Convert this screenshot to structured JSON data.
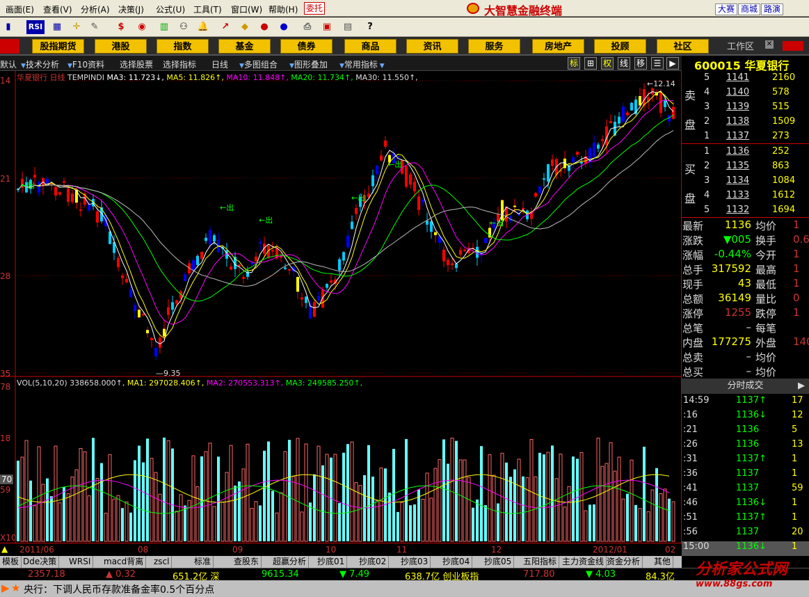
{
  "menu": {
    "items": [
      "画面(E)",
      "查看(V)",
      "分析(A)",
      "决策(J)",
      "公式(U)",
      "工具(T)",
      "窗口(W)",
      "帮助(H)"
    ],
    "entrust": "委托",
    "brand": "大智慧金融终端",
    "right_buttons": [
      "大赛",
      "商城",
      "路演"
    ]
  },
  "toolbar": {
    "rsi": "RSI",
    "dollar": "$"
  },
  "categories": [
    "股指期货",
    "港股",
    "指数",
    "基金",
    "债券",
    "商品",
    "资讯",
    "服务",
    "房地产",
    "投顾",
    "社区"
  ],
  "workarea": "工作区",
  "funcbar": {
    "items": [
      "默认",
      "技术分析",
      "F10资料",
      "选择股票",
      "选择指标",
      "日线",
      "多图组合",
      "图形叠加",
      "常用指标"
    ],
    "squares": [
      "标",
      "⊞",
      "权",
      "线",
      "移",
      "☰",
      "▶"
    ]
  },
  "stock": {
    "code_name": "600015 华夏银行"
  },
  "main_legend": {
    "name": "华夏银行",
    "period": "日线",
    "ind": "TEMPINDI",
    "ma3": "MA3: 11.723",
    "ma5": "MA5: 11.826",
    "ma10": "MA10: 11.848",
    "ma20": "MA20: 11.734",
    "ma30": "MA30: 11.550"
  },
  "vol_legend": {
    "vol": "VOL(5,10,20) 338658.000",
    "ma1": "MA1: 297028.406",
    "ma2": "MA2: 270553.313",
    "ma3": "MA3: 249585.250"
  },
  "y_labels": {
    "p1": "14",
    "p2": "21",
    "p3": "28",
    "p4": "35",
    "v1": "78",
    "v2": "18",
    "v3": "70",
    "v4": "59",
    "v5": "X10"
  },
  "annotations": {
    "high": "12.14",
    "low": "9.35",
    "out": "出"
  },
  "x_labels": [
    "2011/06",
    "08",
    "09",
    "10",
    "11",
    "12",
    "2012/01",
    "02"
  ],
  "orderbook": {
    "sell_label": "卖盘",
    "buy_label": "买盘",
    "sell": [
      {
        "lv": "5",
        "price": "1141",
        "vol": "2160"
      },
      {
        "lv": "4",
        "price": "1140",
        "vol": "578"
      },
      {
        "lv": "3",
        "price": "1139",
        "vol": "515"
      },
      {
        "lv": "2",
        "price": "1138",
        "vol": "1509"
      },
      {
        "lv": "1",
        "price": "1137",
        "vol": "273"
      }
    ],
    "buy": [
      {
        "lv": "1",
        "price": "1136",
        "vol": "252"
      },
      {
        "lv": "2",
        "price": "1135",
        "vol": "863"
      },
      {
        "lv": "3",
        "price": "1134",
        "vol": "1084"
      },
      {
        "lv": "4",
        "price": "1133",
        "vol": "1612"
      },
      {
        "lv": "5",
        "price": "1132",
        "vol": "1694"
      }
    ]
  },
  "stats": [
    {
      "k1": "最新",
      "v1": "1136",
      "k2": "均价",
      "v2": "1"
    },
    {
      "k1": "涨跌",
      "v1": "▼005",
      "k2": "换手",
      "v2": "0.6"
    },
    {
      "k1": "涨幅",
      "v1": "-0.44%",
      "k2": "今开",
      "v2": "1"
    },
    {
      "k1": "总手",
      "v1": "317592",
      "k2": "最高",
      "v2": "1"
    },
    {
      "k1": "现手",
      "v1": "43",
      "k2": "最低",
      "v2": "1"
    },
    {
      "k1": "总额",
      "v1": "36149",
      "k2": "量比",
      "v2": "0"
    },
    {
      "k1": "涨停",
      "v1": "1255",
      "k2": "跌停",
      "v2": "1"
    },
    {
      "k1": "总笔",
      "v1": "–",
      "k2": "每笔",
      "v2": ""
    },
    {
      "k1": "内盘",
      "v1": "177275",
      "k2": "外盘",
      "v2": "140"
    },
    {
      "k1": "总卖",
      "v1": "–",
      "k2": "均价",
      "v2": ""
    },
    {
      "k1": "总买",
      "v1": "–",
      "k2": "均价",
      "v2": ""
    }
  ],
  "ticks_title": "分时成交",
  "ticks": [
    {
      "t": "14:59",
      "p": "1137↑",
      "v": "17"
    },
    {
      "t": ":16",
      "p": "1136↓",
      "v": "12"
    },
    {
      "t": ":21",
      "p": "1136",
      "v": "5"
    },
    {
      "t": ":26",
      "p": "1136",
      "v": "13"
    },
    {
      "t": ":31",
      "p": "1137↑",
      "v": "1"
    },
    {
      "t": ":36",
      "p": "1137",
      "v": "1"
    },
    {
      "t": ":41",
      "p": "1137",
      "v": "59"
    },
    {
      "t": ":46",
      "p": "1136↓",
      "v": "1"
    },
    {
      "t": ":51",
      "p": "1137↑",
      "v": "1"
    },
    {
      "t": ":56",
      "p": "1137",
      "v": "20"
    },
    {
      "t": "15:00",
      "p": "1136↓",
      "v": "1"
    }
  ],
  "tabs": [
    "模板",
    "Dde决策",
    "WRSI",
    "macd背离",
    "zscl",
    "标准",
    "查股东",
    "超赢分析",
    "抄底01",
    "抄底02",
    "抄底03",
    "抄底04",
    "抄底05",
    "五阳指标",
    "主力资金线",
    "资金分析",
    "其他"
  ],
  "index": [
    {
      "t": "2357.18",
      "c": "#c33"
    },
    {
      "t": "▲ 0.32",
      "c": "#c33"
    },
    {
      "t": "651.2亿 深",
      "c": "#ff0"
    },
    {
      "t": "9615.34",
      "c": "#0f0"
    },
    {
      "t": "▼ 7.49",
      "c": "#0f0"
    },
    {
      "t": "638.7亿 创业板指",
      "c": "#ff0"
    },
    {
      "t": "717.80",
      "c": "#c33"
    },
    {
      "t": "▼ 4.03",
      "c": "#0f0"
    },
    {
      "t": "84.3亿",
      "c": "#ff0"
    }
  ],
  "news": "央行：下调人民币存款准备金率0.5个百分点",
  "site": {
    "name": "分析家公式网",
    "url": "www.88gs.com"
  },
  "chart_data": {
    "type": "candlestick",
    "high": 12.14,
    "low": 9.35
  }
}
